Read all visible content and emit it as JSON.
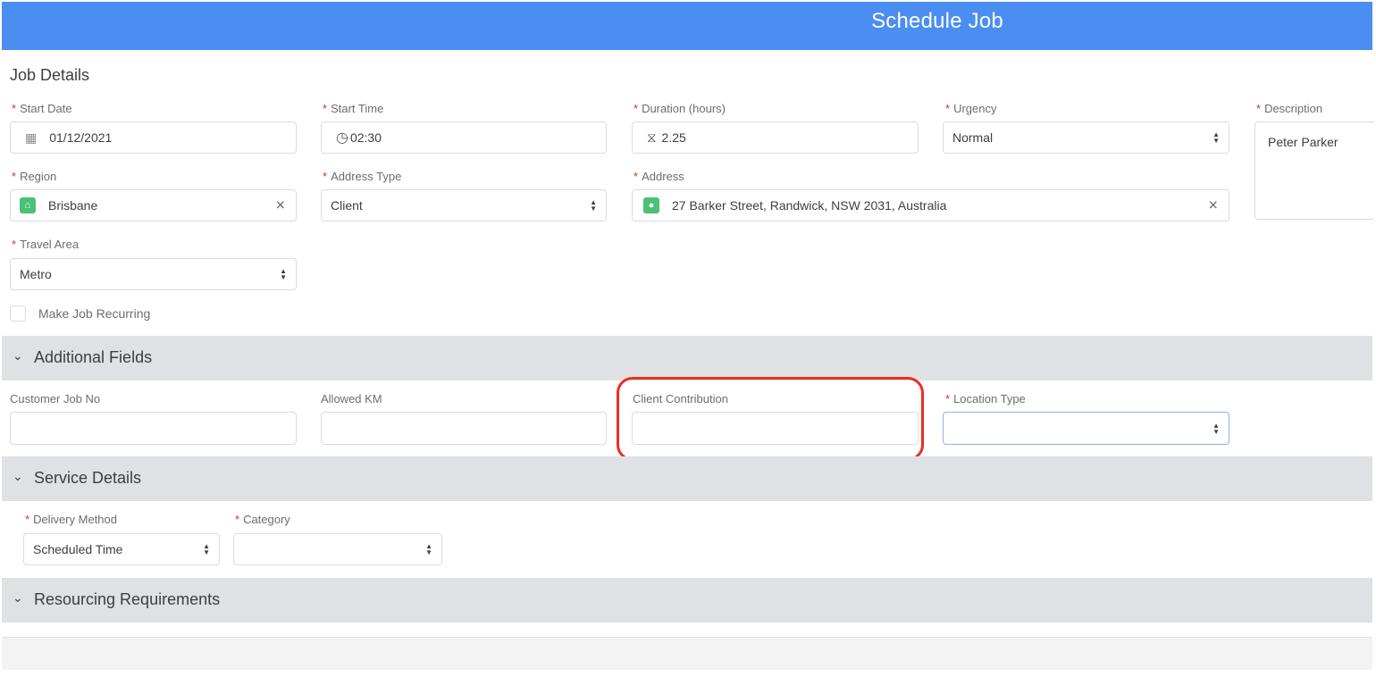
{
  "header": {
    "title": "Schedule Job"
  },
  "job_details": {
    "title": "Job Details",
    "start_date": {
      "label": "Start Date",
      "value": "01/12/2021",
      "icon": "calendar-icon"
    },
    "start_time": {
      "label": "Start Time",
      "value": "02:30",
      "icon": "clock-icon"
    },
    "duration": {
      "label": "Duration (hours)",
      "value": "2.25",
      "icon": "hourglass-icon"
    },
    "urgency": {
      "label": "Urgency",
      "value": "Normal"
    },
    "description": {
      "label": "Description",
      "value": "Peter Parker"
    },
    "region": {
      "label": "Region",
      "value": "Brisbane"
    },
    "address_type": {
      "label": "Address Type",
      "value": "Client"
    },
    "address": {
      "label": "Address",
      "value": "27 Barker Street, Randwick, NSW 2031, Australia"
    },
    "travel_area": {
      "label": "Travel Area",
      "value": "Metro"
    },
    "recurring": {
      "label": "Make Job Recurring"
    }
  },
  "additional_fields": {
    "title": "Additional Fields",
    "customer_job_no": {
      "label": "Customer Job No",
      "value": ""
    },
    "allowed_km": {
      "label": "Allowed KM",
      "value": ""
    },
    "client_contribution": {
      "label": "Client Contribution",
      "value": ""
    },
    "location_type": {
      "label": "Location Type",
      "value": ""
    }
  },
  "service_details": {
    "title": "Service Details",
    "delivery_method": {
      "label": "Delivery Method",
      "value": "Scheduled Time"
    },
    "category": {
      "label": "Category",
      "value": ""
    }
  },
  "resourcing": {
    "title": "Resourcing Requirements"
  },
  "symbols": {
    "required": "*",
    "clear": "×",
    "chevron": "⌄",
    "calendar": "▦",
    "clock": "◷",
    "hourglass": "⧖",
    "lookup": "⌂",
    "spin_up": "▲",
    "spin_down": "▼"
  },
  "colors": {
    "header": "#4a8ef2",
    "required": "#c23934",
    "highlight": "#e8311e",
    "band": "#dfe1e5"
  }
}
